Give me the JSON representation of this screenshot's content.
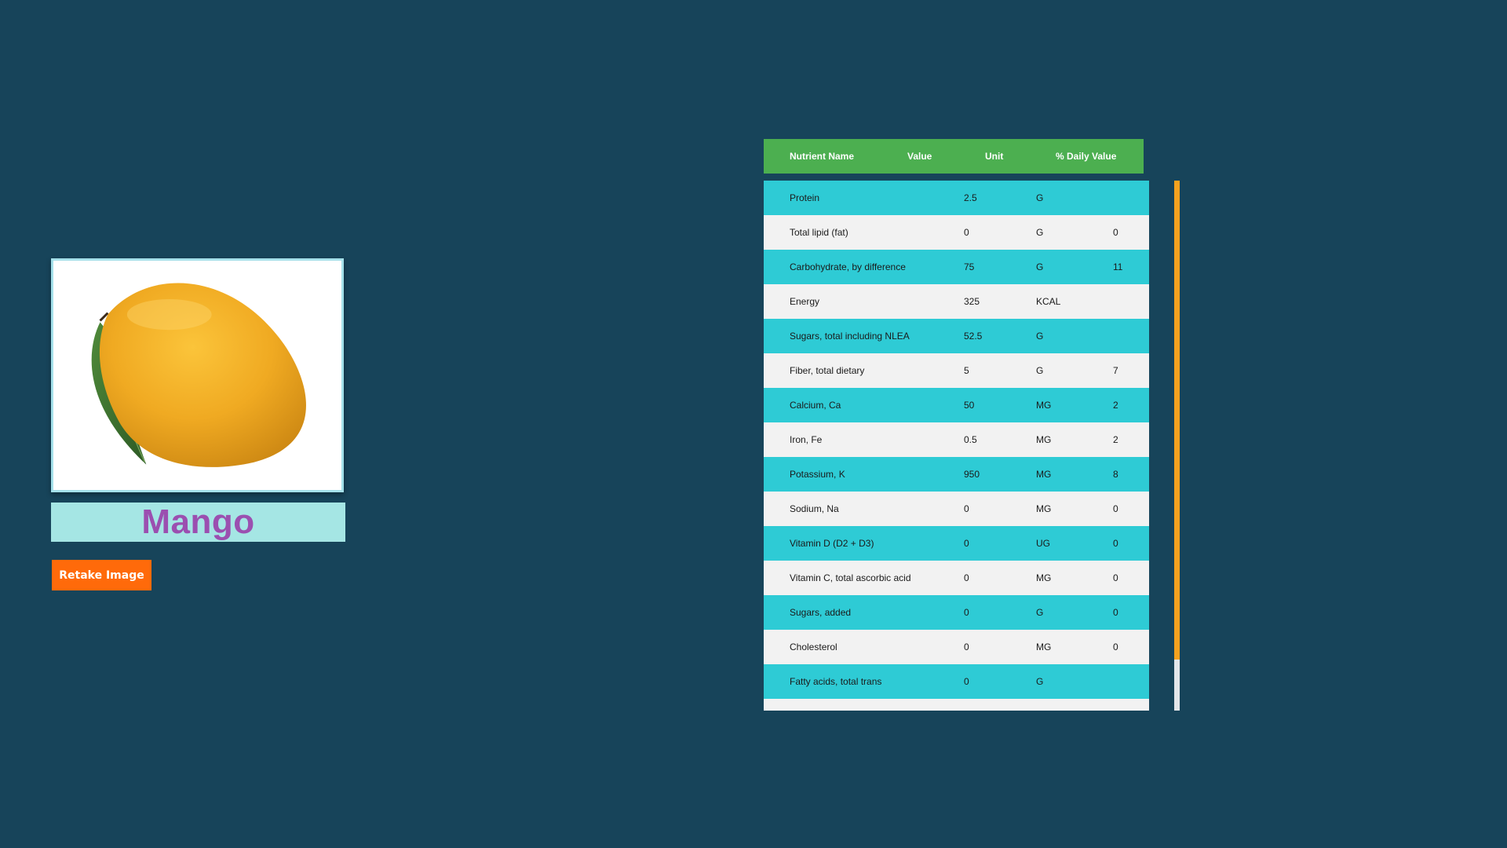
{
  "fruit": {
    "name": "Mango",
    "image_label": "mango"
  },
  "buttons": {
    "retake_label": "Retake Image"
  },
  "table": {
    "headers": {
      "name": "Nutrient Name",
      "value": "Value",
      "unit": "Unit",
      "daily_value": "% Daily Value"
    },
    "rows": [
      {
        "name": "Protein",
        "value": "2.5",
        "unit": "G",
        "daily_value": ""
      },
      {
        "name": "Total lipid (fat)",
        "value": "0",
        "unit": "G",
        "daily_value": "0"
      },
      {
        "name": "Carbohydrate, by difference",
        "value": "75",
        "unit": "G",
        "daily_value": "11"
      },
      {
        "name": "Energy",
        "value": "325",
        "unit": "KCAL",
        "daily_value": ""
      },
      {
        "name": "Sugars, total including NLEA",
        "value": "52.5",
        "unit": "G",
        "daily_value": ""
      },
      {
        "name": "Fiber, total dietary",
        "value": "5",
        "unit": "G",
        "daily_value": "7"
      },
      {
        "name": "Calcium, Ca",
        "value": "50",
        "unit": "MG",
        "daily_value": "2"
      },
      {
        "name": "Iron, Fe",
        "value": "0.5",
        "unit": "MG",
        "daily_value": "2"
      },
      {
        "name": "Potassium, K",
        "value": "950",
        "unit": "MG",
        "daily_value": "8"
      },
      {
        "name": "Sodium, Na",
        "value": "0",
        "unit": "MG",
        "daily_value": "0"
      },
      {
        "name": "Vitamin D (D2 + D3)",
        "value": "0",
        "unit": "UG",
        "daily_value": "0"
      },
      {
        "name": "Vitamin C, total ascorbic acid",
        "value": "0",
        "unit": "MG",
        "daily_value": "0"
      },
      {
        "name": "Sugars, added",
        "value": "0",
        "unit": "G",
        "daily_value": "0"
      },
      {
        "name": "Cholesterol",
        "value": "0",
        "unit": "MG",
        "daily_value": "0"
      },
      {
        "name": "Fatty acids, total trans",
        "value": "0",
        "unit": "G",
        "daily_value": ""
      },
      {
        "name": "",
        "value": "",
        "unit": "",
        "daily_value": ""
      }
    ]
  },
  "colors": {
    "background": "#17445a",
    "header": "#4caf50",
    "row_odd": "#2ecbd5",
    "row_even": "#f2f2f2",
    "button": "#ff6a0a",
    "fruit_name": "#9b4fb0",
    "scrollbar_thumb": "#f5a21f"
  }
}
